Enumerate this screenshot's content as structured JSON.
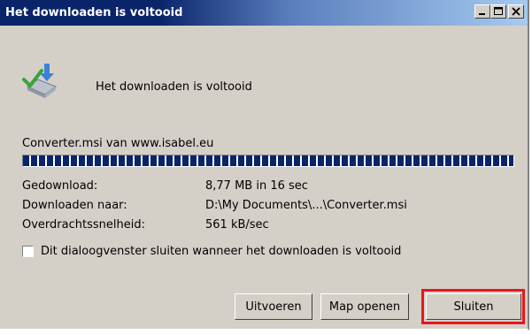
{
  "window": {
    "title": "Het downloaden is voltooid",
    "controls": {
      "minimize": "minimize-icon",
      "maximize": "maximize-icon",
      "close": "close-icon"
    }
  },
  "dialog": {
    "icon": "download-complete-icon",
    "headline": "Het downloaden is voltooid",
    "source": "Converter.msi van www.isabel.eu",
    "progress_percent": 100,
    "details": [
      {
        "label": "Gedownload:",
        "value": "8,77 MB in 16 sec"
      },
      {
        "label": "Downloaden naar:",
        "value": "D:\\My Documents\\...\\Converter.msi"
      },
      {
        "label": "Overdrachtssnelheid:",
        "value": "561 kB/sec"
      }
    ],
    "checkbox": {
      "label": "Dit dialoogvenster sluiten wanneer het downloaden is voltooid",
      "checked": false
    }
  },
  "buttons": {
    "run": "Uitvoeren",
    "open_folder": "Map openen",
    "close": "Sluiten"
  },
  "colors": {
    "highlight": "#e8161b",
    "titlebar": "#0a246a",
    "progress": "#0a246a"
  }
}
